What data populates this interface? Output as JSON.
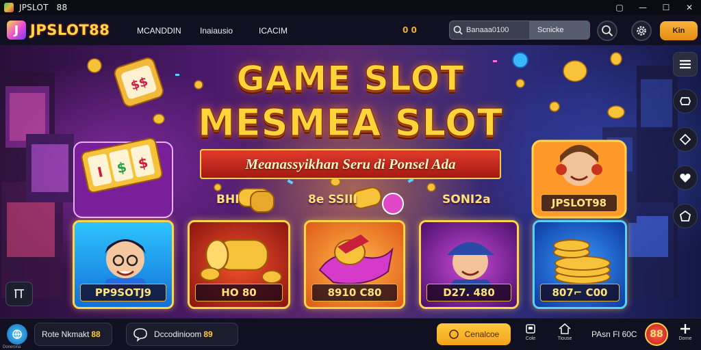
{
  "window": {
    "title": "JPSLOT   88",
    "controls": [
      "▢",
      "—",
      "☐",
      "✕"
    ]
  },
  "navbar": {
    "logo_mark": "J",
    "logo_text": "JPSLOT88",
    "links": [
      "MCANDDIN",
      "Inaiausio",
      "ICACIM"
    ],
    "coin_count": "0 0",
    "search": {
      "value": "Banaaa0100",
      "select": "Scnicke"
    },
    "login_label": "Kin"
  },
  "banner": {
    "headline_1": "GAME SLOT",
    "headline_2": "MESMEA SLOT",
    "ribbon": "Meanassyikhan Seru di Ponsel Ada",
    "mid_labels": [
      "BHI",
      "8e SSIII",
      "SONI2a"
    ],
    "top_right_card_label": "JPSLOT98",
    "cards": [
      {
        "label": "PP9SOTJ9"
      },
      {
        "label": "HO 80"
      },
      {
        "label": "8910 C80"
      },
      {
        "label": "D27. 480"
      },
      {
        "label": "807⌐ C00"
      }
    ]
  },
  "side_rail": [
    "menu-icon",
    "chat-bubble-icon",
    "diamond-icon",
    "heart-icon",
    "pentagon-icon"
  ],
  "bottombar": {
    "app_sub": "Donerona",
    "pill_1": {
      "text": "Rote Nkmakt",
      "accent": "88"
    },
    "pill_2": {
      "text": "Dccodinioom",
      "accent": "89"
    },
    "cta_label": "Cenalcoe",
    "tools": [
      {
        "label": "Cole"
      },
      {
        "label": "Tiouse"
      }
    ],
    "balance": "PAsn Fl 60C",
    "badge": "88",
    "plus_label": "Dorne"
  },
  "colors": {
    "accent_gold": "#ffd43b",
    "login_orange": "#f0a020",
    "ribbon_red": "#c8281e",
    "nav_bg": "#101020"
  }
}
